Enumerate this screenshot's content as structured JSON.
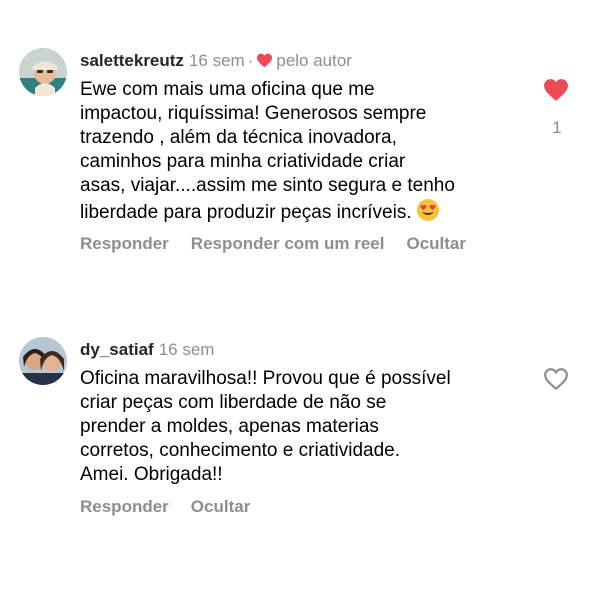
{
  "comments": [
    {
      "username": "salettekreutz",
      "time": "16 sem",
      "separator": "·",
      "author_liked_label": "pelo autor",
      "text": "Ewe com mais uma oficina que me\nimpactou, riquíssima! Generosos sempre\ntrazendo , além da técnica inovadora,\ncaminhos para minha criatividade criar\nasas, viajar....assim me sinto segura e tenho\nliberdade para produzir peças incríveis.",
      "emoji": "heart-eyes-emoji",
      "liked": true,
      "like_count": "1",
      "actions": [
        "Responder",
        "Responder com um reel",
        "Ocultar"
      ],
      "heart_color": "#ed4956"
    },
    {
      "username": "dy_satiaf",
      "time": "16 sem",
      "text": "Oficina maravilhosa!! Provou que é possível\ncriar peças com liberdade de não se\nprender a moldes, apenas materias\ncorretos, conhecimento e criatividade.\nAmei. Obrigada!!",
      "liked": false,
      "actions": [
        "Responder",
        "Ocultar"
      ]
    }
  ],
  "icons": {
    "like_outline": "heart-outline-icon",
    "like_filled": "heart-filled-icon"
  }
}
